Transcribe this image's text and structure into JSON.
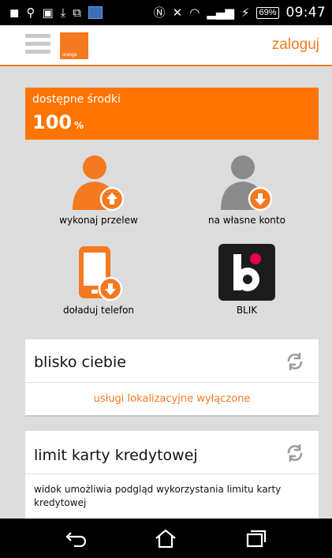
{
  "status_bar": {
    "icons_left": [
      "signal-app-icon",
      "usb-icon",
      "gallery-icon",
      "download-icon",
      "screen-icon",
      "app-thumbnail-icon"
    ],
    "icons_right": [
      "nfc-icon",
      "mute-icon",
      "wifi-icon",
      "cell-signal-icon",
      "charging-icon"
    ],
    "battery": "69%",
    "time": "09:47"
  },
  "header": {
    "logo_text": "orange",
    "login_label": "zaloguj"
  },
  "funds": {
    "label": "dostępne środki",
    "value": "100",
    "unit": "%"
  },
  "actions": [
    {
      "label": "wykonaj przelew",
      "icon": "person-send-icon"
    },
    {
      "label": "na własne konto",
      "icon": "person-receive-icon"
    },
    {
      "label": "doładuj telefon",
      "icon": "phone-topup-icon"
    },
    {
      "label": "BLIK",
      "icon": "blik-icon"
    }
  ],
  "cards": {
    "nearby": {
      "title": "blisko ciebie",
      "status": "usługi lokalizacyjne wyłączone"
    },
    "credit_limit": {
      "title": "limit karty kredytowej",
      "description": "widok umożliwia podgląd wykorzystania limitu karty kredytowej"
    }
  },
  "nav": [
    "back-icon",
    "home-icon",
    "recent-apps-icon"
  ],
  "colors": {
    "accent": "#f47920",
    "banner": "#ff7300",
    "background": "#dcdcdc"
  }
}
